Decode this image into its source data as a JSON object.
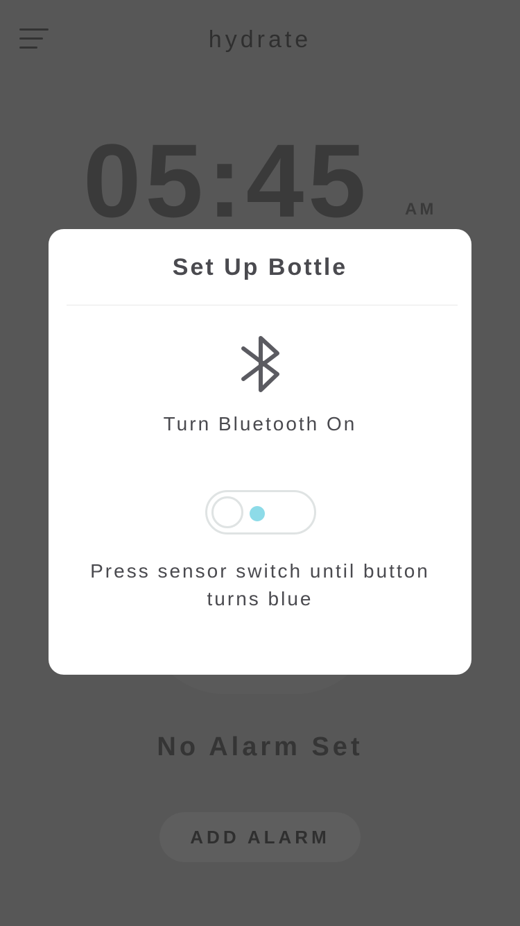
{
  "header": {
    "title": "hydrate",
    "menu_icon": "hamburger-menu-icon"
  },
  "clock": {
    "time": "05:45",
    "period": "AM"
  },
  "alarm": {
    "status": "No Alarm Set",
    "add_label": "ADD ALARM"
  },
  "modal": {
    "title": "Set Up Bottle",
    "bluetooth_icon": "bluetooth-icon",
    "bluetooth_label": "Turn Bluetooth On",
    "toggle_indicator_color": "#8ddbe8",
    "instructions": "Press sensor switch until button turns blue"
  },
  "colors": {
    "overlay_background": "#575757",
    "modal_background": "#ffffff",
    "text": "#4a4a4f",
    "toggle_border": "#dfe3e3"
  }
}
